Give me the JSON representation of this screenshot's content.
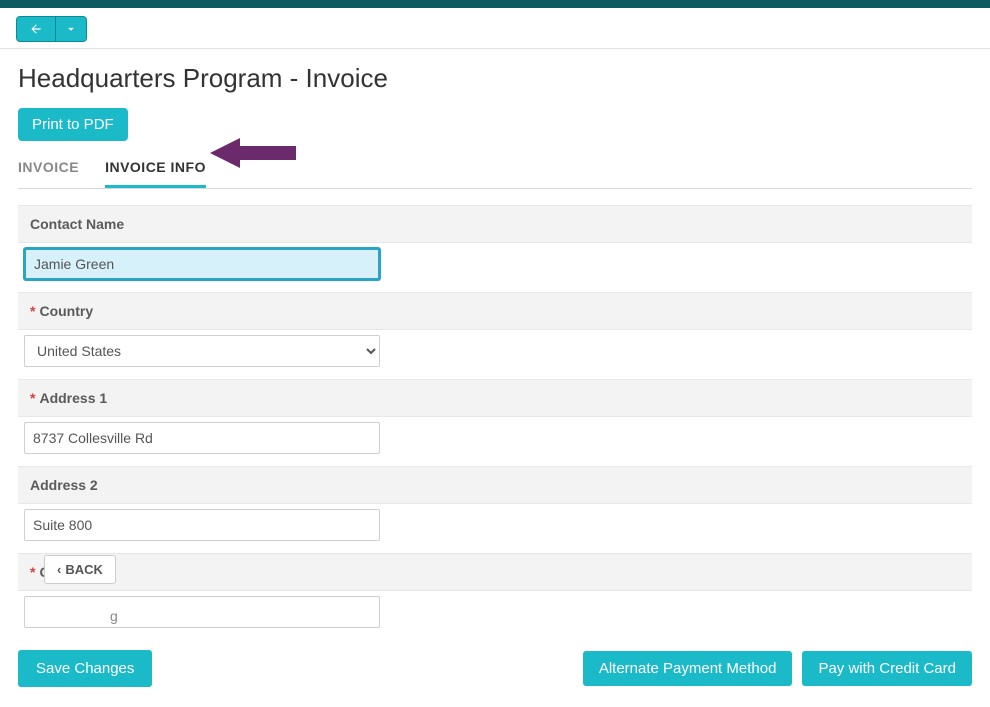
{
  "header": {
    "title": "Headquarters Program - Invoice",
    "print_label": "Print to PDF"
  },
  "tabs": [
    {
      "label": "INVOICE",
      "active": false
    },
    {
      "label": "INVOICE INFO",
      "active": true
    }
  ],
  "form": {
    "contact_name": {
      "label": "Contact Name",
      "value": "Jamie Green",
      "required": false
    },
    "country": {
      "label": "Country",
      "value": "United States",
      "required": true
    },
    "address1": {
      "label": "Address 1",
      "value": "8737 Collesville Rd",
      "required": true
    },
    "address2": {
      "label": "Address 2",
      "value": "Suite 800",
      "required": false
    },
    "city": {
      "label": "City",
      "value_partial": "g",
      "required": true
    }
  },
  "buttons": {
    "back": "BACK",
    "save": "Save Changes",
    "alt_payment": "Alternate Payment Method",
    "pay_cc": "Pay with Credit Card"
  }
}
